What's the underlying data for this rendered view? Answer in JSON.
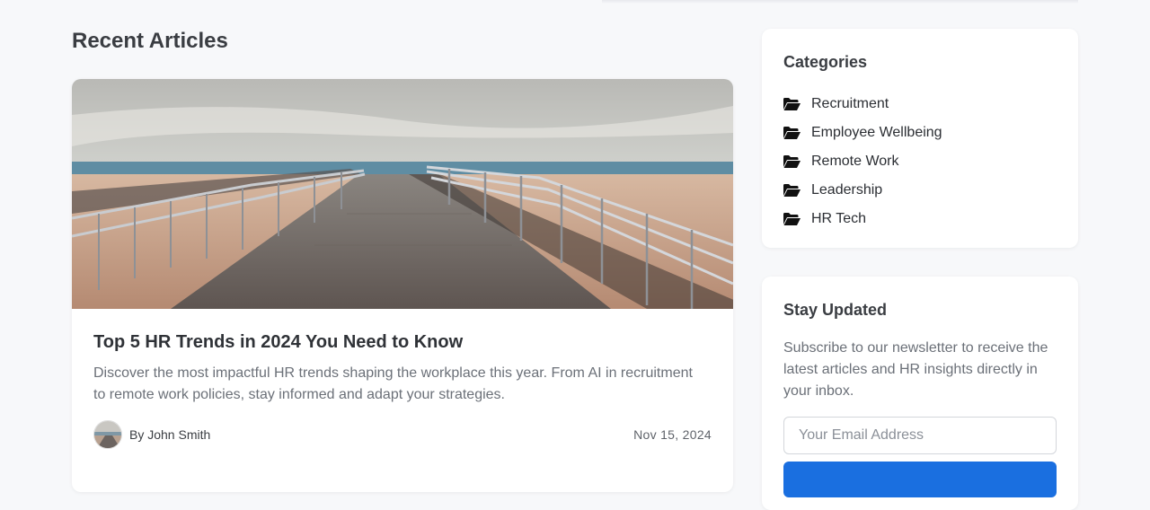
{
  "main": {
    "section_title": "Recent Articles",
    "article": {
      "title": "Top 5 HR Trends in 2024 You Need to Know",
      "excerpt": "Discover the most impactful HR trends shaping the workplace this year. From AI in recruitment to remote work policies, stay informed and adapt your strategies.",
      "author": "By John Smith",
      "date": "Nov 15, 2024",
      "image": "boardwalk-beach-photo"
    }
  },
  "sidebar": {
    "categories": {
      "title": "Categories",
      "icon": "folder-open-icon",
      "items": [
        {
          "label": "Recruitment"
        },
        {
          "label": "Employee Wellbeing"
        },
        {
          "label": "Remote Work"
        },
        {
          "label": "Leadership"
        },
        {
          "label": "HR Tech"
        }
      ]
    },
    "newsletter": {
      "title": "Stay Updated",
      "description": "Subscribe to our newsletter to receive the latest articles and HR insights directly in your inbox.",
      "email_placeholder": "Your Email Address",
      "accent": "#1a6fe0"
    }
  }
}
